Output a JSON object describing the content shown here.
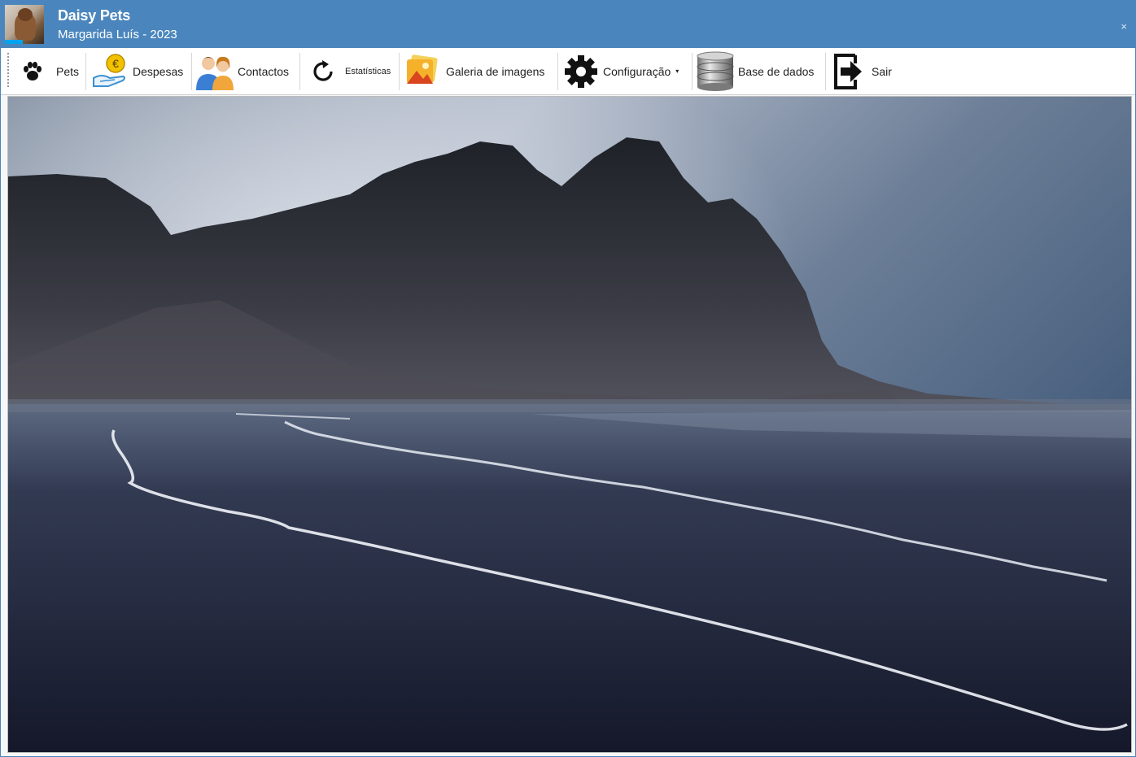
{
  "app": {
    "title": "Daisy Pets",
    "subtitle": "Margarida Luís - 2023",
    "close_label": "×",
    "accent_color": "#4a86bd"
  },
  "toolbar": {
    "items": [
      {
        "label": "Pets",
        "icon": "paw-icon"
      },
      {
        "label": "Despesas",
        "icon": "euro-hand-icon"
      },
      {
        "label": "Contactos",
        "icon": "people-icon"
      },
      {
        "label": "Estatísticas",
        "icon": "refresh-icon"
      },
      {
        "label": "Galeria de imagens",
        "icon": "gallery-icon"
      },
      {
        "label": "Configuração",
        "icon": "gear-icon",
        "dropdown": "▾"
      },
      {
        "label": "Base de dados",
        "icon": "database-icon"
      },
      {
        "label": "Sair",
        "icon": "exit-icon"
      }
    ]
  }
}
